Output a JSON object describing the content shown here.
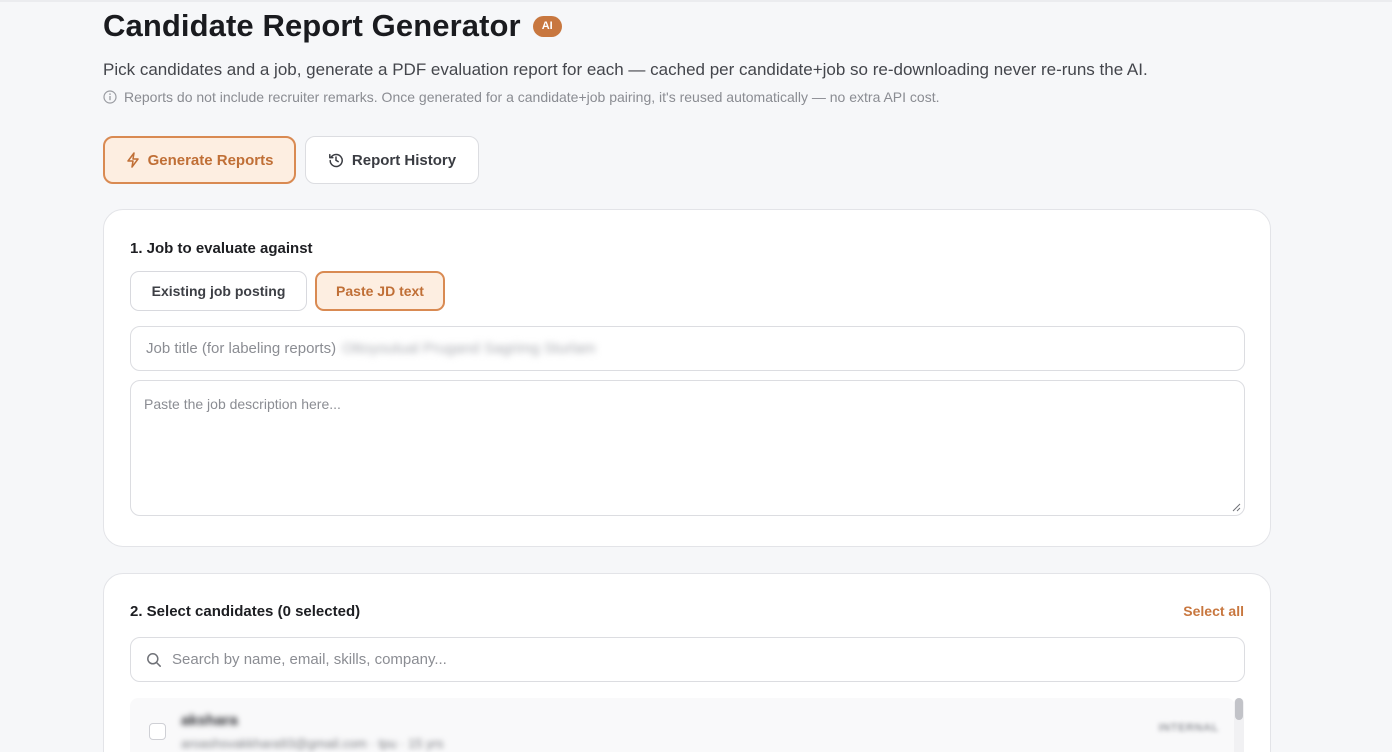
{
  "header": {
    "title": "Candidate Report Generator",
    "badge": "AI",
    "subtitle": "Pick candidates and a job, generate a PDF evaluation report for each — cached per candidate+job so re-downloading never re-runs the AI.",
    "note": "Reports do not include recruiter remarks. Once generated for a candidate+job pairing, it's reused automatically — no extra API cost.",
    "note_icon": "info-icon"
  },
  "tabs": {
    "generate": {
      "label": "Generate Reports",
      "icon": "lightning-icon",
      "active": true
    },
    "history": {
      "label": "Report History",
      "icon": "history-icon",
      "active": false
    }
  },
  "job_section": {
    "title": "1. Job to evaluate against",
    "modes": {
      "existing": {
        "label": "Existing job posting",
        "active": false
      },
      "paste": {
        "label": "Paste JD text",
        "active": true
      }
    },
    "job_title_placeholder": "Job title (for labeling reports)",
    "job_title_value": "Ottoyoutual Prugand Sagrimg Sturlam",
    "jd_placeholder": "Paste the job description here..."
  },
  "candidates_section": {
    "title": "2. Select candidates (0 selected)",
    "select_all": "Select all",
    "search_placeholder": "Search by name, email, skills, company...",
    "candidates": [
      {
        "name": "akshara",
        "meta": "aroashsvakkhara93@gmail.com · tpu · 15 yrs",
        "tag": "INTERNAL",
        "selected": false
      }
    ]
  },
  "colors": {
    "accent": "#c8773f",
    "accent_bg": "#fdeee1",
    "accent_border": "#d98a52"
  }
}
